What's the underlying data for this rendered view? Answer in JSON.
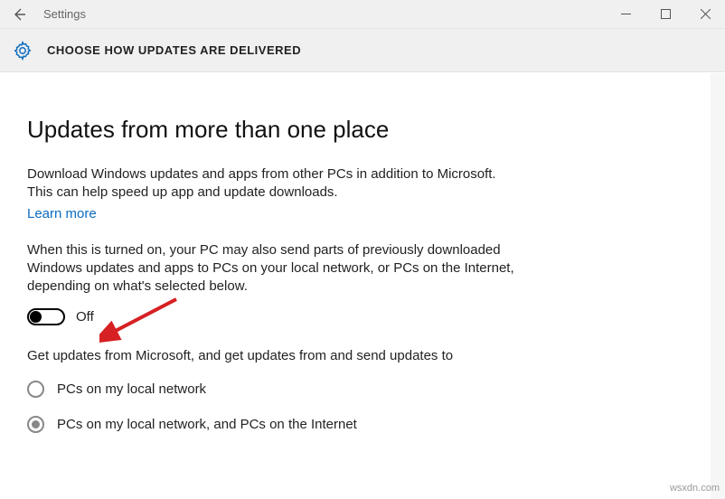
{
  "titlebar": {
    "app_title": "Settings"
  },
  "subheader": {
    "page_title": "CHOOSE HOW UPDATES ARE DELIVERED"
  },
  "main": {
    "heading": "Updates from more than one place",
    "intro": "Download Windows updates and apps from other PCs in addition to Microsoft. This can help speed up app and update downloads.",
    "learn_more": "Learn more",
    "explain": "When this is turned on, your PC may also send parts of previously downloaded Windows updates and apps to PCs on your local network, or PCs on the Internet, depending on what's selected below.",
    "toggle_state": "Off",
    "get_updates": "Get updates from Microsoft, and get updates from and send updates to",
    "options": [
      {
        "label": "PCs on my local network",
        "selected": false
      },
      {
        "label": "PCs on my local network, and PCs on the Internet",
        "selected": true
      }
    ]
  },
  "watermark": "wsxdn.com"
}
